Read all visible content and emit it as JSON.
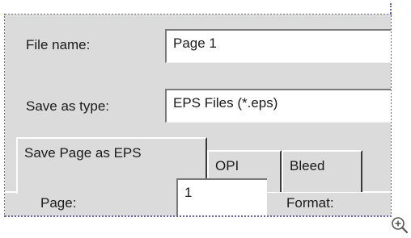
{
  "dialog": {
    "file_name_label": "File name:",
    "file_name_value": "Page 1",
    "save_as_type_label": "Save as type:",
    "save_as_type_value": "EPS Files (*.eps)",
    "tabs": [
      {
        "label": "Save Page as EPS",
        "active": true
      },
      {
        "label": "OPI",
        "active": false
      },
      {
        "label": "Bleed",
        "active": false
      }
    ],
    "page_label": "Page:",
    "page_value": "1",
    "format_label": "Format:"
  },
  "icons": {
    "zoom": "zoom-in-icon"
  },
  "colors": {
    "dialog_bg": "#dbdbdb",
    "dotted_border": "#6666aa"
  }
}
